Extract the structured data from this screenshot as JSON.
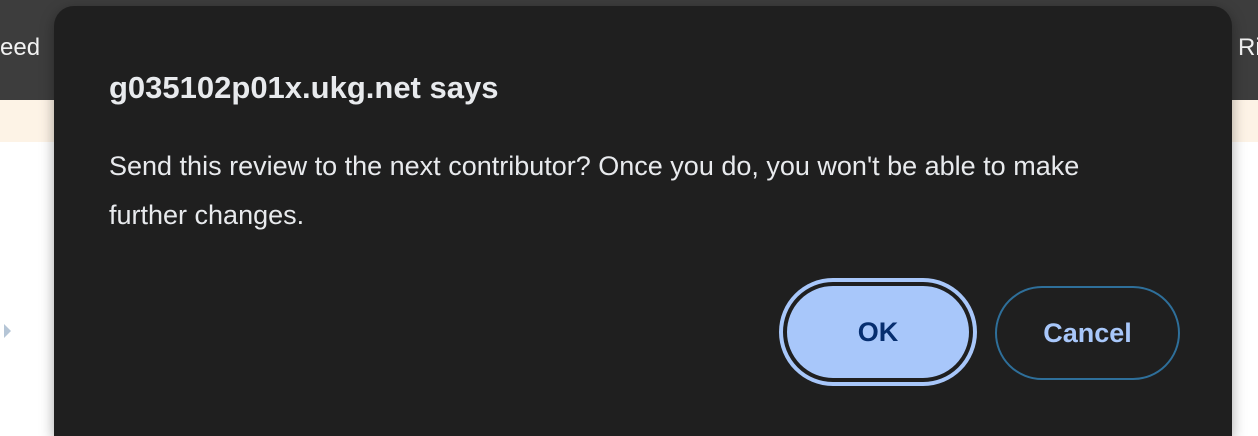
{
  "background": {
    "left_text": "eed",
    "right_text": "Ri"
  },
  "dialog": {
    "title": "g035102p01x.ukg.net says",
    "message": "Send this review to the next contributor?  Once you do, you won't be able to make further changes.",
    "ok_label": "OK",
    "cancel_label": "Cancel"
  },
  "colors": {
    "dialog_background": "#1f1f1f",
    "primary_button": "#a8c7fa",
    "primary_button_text": "#062e6f",
    "secondary_button_border": "#2e6f9a"
  }
}
